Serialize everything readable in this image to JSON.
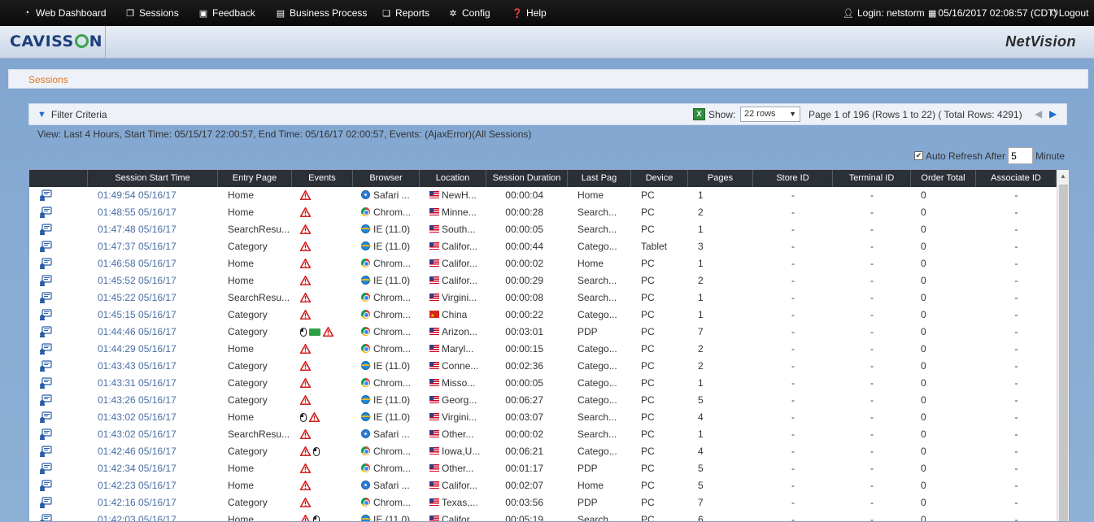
{
  "nav": {
    "items": [
      {
        "label": "Web Dashboard",
        "icon": "dashboard-icon",
        "glyph": "◔"
      },
      {
        "label": "Sessions",
        "icon": "sessions-icon",
        "glyph": "❐"
      },
      {
        "label": "Feedback",
        "icon": "feedback-icon",
        "glyph": "▣"
      },
      {
        "label": "Business Process",
        "icon": "business-process-icon",
        "glyph": "▤"
      },
      {
        "label": "Reports",
        "icon": "reports-icon",
        "glyph": "❏"
      },
      {
        "label": "Config",
        "icon": "config-icon",
        "glyph": "✲"
      },
      {
        "label": "Help",
        "icon": "help-icon",
        "glyph": "❓"
      }
    ],
    "login_label": "Login: netstorm",
    "datetime": "05/16/2017 02:08:57 (CDT)",
    "logout_label": "Logout"
  },
  "brand": {
    "logo_left": "CAVISS",
    "logo_right": "N",
    "product": "NetVision"
  },
  "page": {
    "title": "Sessions"
  },
  "filter": {
    "toggle_label": "Filter Criteria",
    "show_label": "Show:",
    "rows_value": "22 rows",
    "page_info": "Page 1 of 196 (Rows 1 to 22) ( Total Rows: 4291)",
    "view_text": "View: Last 4 Hours, Start Time: 05/15/17 22:00:57, End Time: 05/16/17 02:00:57, Events: (AjaxError)(All Sessions)",
    "auto_refresh_label": "Auto Refresh After",
    "auto_refresh_value": "5",
    "auto_refresh_unit": "Minute"
  },
  "table": {
    "columns": [
      "",
      "Session Start Time",
      "Entry Page",
      "Events",
      "Browser",
      "Location",
      "Session Duration",
      "Last Pag",
      "Device",
      "Pages",
      "Store ID",
      "Terminal ID",
      "Order Total",
      "Associate ID"
    ],
    "rows": [
      {
        "time": "01:49:54 05/16/17",
        "entry": "Home",
        "events": [
          "warn"
        ],
        "browser": "safari",
        "browser_label": "Safari ...",
        "flag": "us",
        "location": "NewH...",
        "duration": "00:00:04",
        "last": "Home",
        "device": "PC",
        "pages": "1",
        "store": "-",
        "terminal": "-",
        "order": "0",
        "assoc": "-"
      },
      {
        "time": "01:48:55 05/16/17",
        "entry": "Home",
        "events": [
          "warn"
        ],
        "browser": "chrome",
        "browser_label": "Chrom...",
        "flag": "us",
        "location": "Minne...",
        "duration": "00:00:28",
        "last": "Search...",
        "device": "PC",
        "pages": "2",
        "store": "-",
        "terminal": "-",
        "order": "0",
        "assoc": "-"
      },
      {
        "time": "01:47:48 05/16/17",
        "entry": "SearchResu...",
        "events": [
          "warn"
        ],
        "browser": "ie",
        "browser_label": "IE (11.0)",
        "flag": "us",
        "location": "South...",
        "duration": "00:00:05",
        "last": "Search...",
        "device": "PC",
        "pages": "1",
        "store": "-",
        "terminal": "-",
        "order": "0",
        "assoc": "-"
      },
      {
        "time": "01:47:37 05/16/17",
        "entry": "Category",
        "events": [
          "warn"
        ],
        "browser": "ie",
        "browser_label": "IE (11.0)",
        "flag": "us",
        "location": "Califor...",
        "duration": "00:00:44",
        "last": "Catego...",
        "device": "Tablet",
        "pages": "3",
        "store": "-",
        "terminal": "-",
        "order": "0",
        "assoc": "-"
      },
      {
        "time": "01:46:58 05/16/17",
        "entry": "Home",
        "events": [
          "warn"
        ],
        "browser": "chrome",
        "browser_label": "Chrom...",
        "flag": "us",
        "location": "Califor...",
        "duration": "00:00:02",
        "last": "Home",
        "device": "PC",
        "pages": "1",
        "store": "-",
        "terminal": "-",
        "order": "0",
        "assoc": "-"
      },
      {
        "time": "01:45:52 05/16/17",
        "entry": "Home",
        "events": [
          "warn"
        ],
        "browser": "ie",
        "browser_label": "IE (11.0)",
        "flag": "us",
        "location": "Califor...",
        "duration": "00:00:29",
        "last": "Search...",
        "device": "PC",
        "pages": "2",
        "store": "-",
        "terminal": "-",
        "order": "0",
        "assoc": "-"
      },
      {
        "time": "01:45:22 05/16/17",
        "entry": "SearchResu...",
        "events": [
          "warn"
        ],
        "browser": "chrome",
        "browser_label": "Chrom...",
        "flag": "us",
        "location": "Virgini...",
        "duration": "00:00:08",
        "last": "Search...",
        "device": "PC",
        "pages": "1",
        "store": "-",
        "terminal": "-",
        "order": "0",
        "assoc": "-"
      },
      {
        "time": "01:45:15 05/16/17",
        "entry": "Category",
        "events": [
          "warn"
        ],
        "browser": "chrome",
        "browser_label": "Chrom...",
        "flag": "cn",
        "location": "China",
        "duration": "00:00:22",
        "last": "Catego...",
        "device": "PC",
        "pages": "1",
        "store": "-",
        "terminal": "-",
        "order": "0",
        "assoc": "-"
      },
      {
        "time": "01:44:46 05/16/17",
        "entry": "Category",
        "events": [
          "mouse",
          "truck",
          "warn"
        ],
        "browser": "chrome",
        "browser_label": "Chrom...",
        "flag": "us",
        "location": "Arizon...",
        "duration": "00:03:01",
        "last": "PDP",
        "device": "PC",
        "pages": "7",
        "store": "-",
        "terminal": "-",
        "order": "0",
        "assoc": "-"
      },
      {
        "time": "01:44:29 05/16/17",
        "entry": "Home",
        "events": [
          "warn"
        ],
        "browser": "chrome",
        "browser_label": "Chrom...",
        "flag": "us",
        "location": "Maryl...",
        "duration": "00:00:15",
        "last": "Catego...",
        "device": "PC",
        "pages": "2",
        "store": "-",
        "terminal": "-",
        "order": "0",
        "assoc": "-"
      },
      {
        "time": "01:43:43 05/16/17",
        "entry": "Category",
        "events": [
          "warn"
        ],
        "browser": "ie",
        "browser_label": "IE (11.0)",
        "flag": "us",
        "location": "Conne...",
        "duration": "00:02:36",
        "last": "Catego...",
        "device": "PC",
        "pages": "2",
        "store": "-",
        "terminal": "-",
        "order": "0",
        "assoc": "-"
      },
      {
        "time": "01:43:31 05/16/17",
        "entry": "Category",
        "events": [
          "warn"
        ],
        "browser": "chrome",
        "browser_label": "Chrom...",
        "flag": "us",
        "location": "Misso...",
        "duration": "00:00:05",
        "last": "Catego...",
        "device": "PC",
        "pages": "1",
        "store": "-",
        "terminal": "-",
        "order": "0",
        "assoc": "-"
      },
      {
        "time": "01:43:26 05/16/17",
        "entry": "Category",
        "events": [
          "warn"
        ],
        "browser": "ie",
        "browser_label": "IE (11.0)",
        "flag": "us",
        "location": "Georg...",
        "duration": "00:06:27",
        "last": "Catego...",
        "device": "PC",
        "pages": "5",
        "store": "-",
        "terminal": "-",
        "order": "0",
        "assoc": "-"
      },
      {
        "time": "01:43:02 05/16/17",
        "entry": "Home",
        "events": [
          "mouse",
          "warn"
        ],
        "browser": "ie",
        "browser_label": "IE (11.0)",
        "flag": "us",
        "location": "Virgini...",
        "duration": "00:03:07",
        "last": "Search...",
        "device": "PC",
        "pages": "4",
        "store": "-",
        "terminal": "-",
        "order": "0",
        "assoc": "-"
      },
      {
        "time": "01:43:02 05/16/17",
        "entry": "SearchResu...",
        "events": [
          "warn"
        ],
        "browser": "safari",
        "browser_label": "Safari ...",
        "flag": "us",
        "location": "Other...",
        "duration": "00:00:02",
        "last": "Search...",
        "device": "PC",
        "pages": "1",
        "store": "-",
        "terminal": "-",
        "order": "0",
        "assoc": "-"
      },
      {
        "time": "01:42:46 05/16/17",
        "entry": "Category",
        "events": [
          "warn",
          "mouse"
        ],
        "browser": "chrome",
        "browser_label": "Chrom...",
        "flag": "us",
        "location": "Iowa,U...",
        "duration": "00:06:21",
        "last": "Catego...",
        "device": "PC",
        "pages": "4",
        "store": "-",
        "terminal": "-",
        "order": "0",
        "assoc": "-"
      },
      {
        "time": "01:42:34 05/16/17",
        "entry": "Home",
        "events": [
          "warn"
        ],
        "browser": "chrome",
        "browser_label": "Chrom...",
        "flag": "us",
        "location": "Other...",
        "duration": "00:01:17",
        "last": "PDP",
        "device": "PC",
        "pages": "5",
        "store": "-",
        "terminal": "-",
        "order": "0",
        "assoc": "-"
      },
      {
        "time": "01:42:23 05/16/17",
        "entry": "Home",
        "events": [
          "warn"
        ],
        "browser": "safari",
        "browser_label": "Safari ...",
        "flag": "us",
        "location": "Califor...",
        "duration": "00:02:07",
        "last": "Home",
        "device": "PC",
        "pages": "5",
        "store": "-",
        "terminal": "-",
        "order": "0",
        "assoc": "-"
      },
      {
        "time": "01:42:16 05/16/17",
        "entry": "Category",
        "events": [
          "warn"
        ],
        "browser": "chrome",
        "browser_label": "Chrom...",
        "flag": "us",
        "location": "Texas,...",
        "duration": "00:03:56",
        "last": "PDP",
        "device": "PC",
        "pages": "7",
        "store": "-",
        "terminal": "-",
        "order": "0",
        "assoc": "-"
      },
      {
        "time": "01:42:03 05/16/17",
        "entry": "Home",
        "events": [
          "warn",
          "mouse"
        ],
        "browser": "ie",
        "browser_label": "IE (11.0)",
        "flag": "us",
        "location": "Califor...",
        "duration": "00:05:19",
        "last": "Search...",
        "device": "PC",
        "pages": "6",
        "store": "-",
        "terminal": "-",
        "order": "0",
        "assoc": "-"
      }
    ]
  },
  "colors": {
    "accent_orange": "#e0751c",
    "link_blue": "#4a6fa5",
    "header_dark": "#2b2f36"
  }
}
